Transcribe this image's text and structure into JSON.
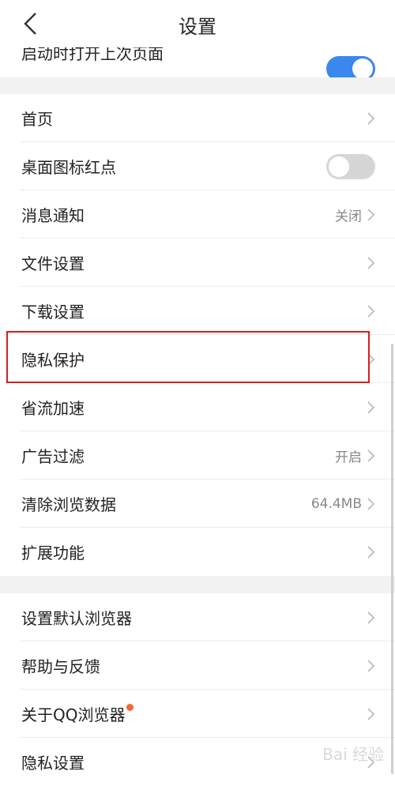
{
  "header": {
    "title": "设置"
  },
  "top_partial_row": {
    "label": "启动时打开上次页面",
    "toggle": "on"
  },
  "sections": [
    {
      "rows": [
        {
          "label": "首页"
        },
        {
          "label": "桌面图标红点",
          "toggle": "off"
        },
        {
          "label": "消息通知",
          "value": "关闭"
        },
        {
          "label": "文件设置"
        },
        {
          "label": "下载设置"
        },
        {
          "label": "隐私保护"
        },
        {
          "label": "省流加速"
        },
        {
          "label": "广告过滤",
          "value": "开启"
        },
        {
          "label": "清除浏览数据",
          "value": "64.4MB"
        },
        {
          "label": "扩展功能"
        }
      ]
    },
    {
      "rows": [
        {
          "label": "设置默认浏览器"
        },
        {
          "label": "帮助与反馈"
        },
        {
          "label": "关于QQ浏览器",
          "badge": true
        },
        {
          "label": "隐私设置"
        }
      ]
    }
  ],
  "watermark": "Bai 经验"
}
